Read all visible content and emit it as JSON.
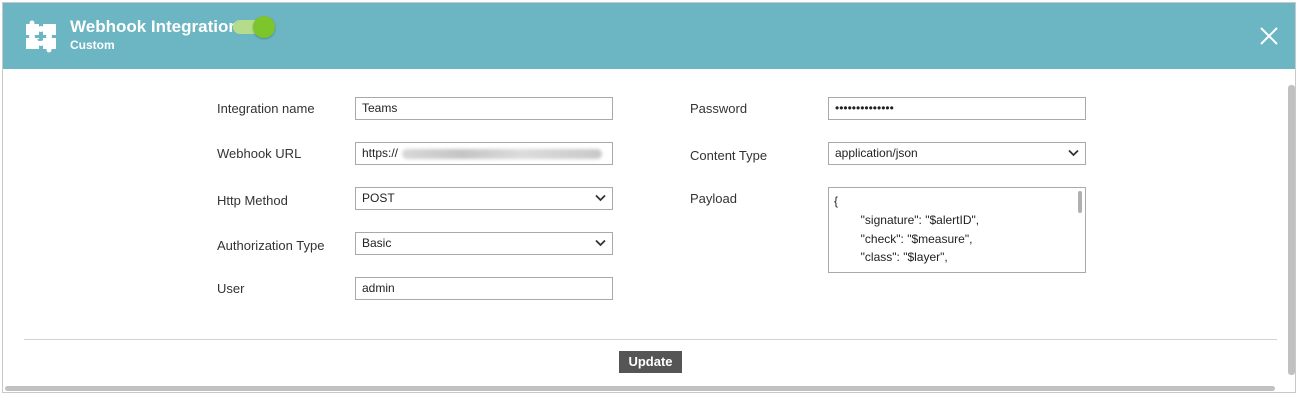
{
  "header": {
    "title": "Webhook Integration",
    "subtitle": "Custom",
    "enabled": true,
    "accent_color": "#6cb5c3",
    "toggle_color": "#7cc52a",
    "logo_icon": "puzzle-icon",
    "close_icon": "close-icon"
  },
  "form": {
    "integration_name": {
      "label": "Integration name",
      "value": "Teams"
    },
    "webhook_url": {
      "label": "Webhook URL",
      "value": "https://"
    },
    "http_method": {
      "label": "Http Method",
      "value": "POST"
    },
    "authorization_type": {
      "label": "Authorization Type",
      "value": "Basic"
    },
    "user": {
      "label": "User",
      "value": "admin"
    },
    "password": {
      "label": "Password",
      "value": "••••••••••••••"
    },
    "content_type": {
      "label": "Content Type",
      "value": "application/json"
    },
    "payload": {
      "label": "Payload",
      "lines": [
        "{",
        "        \"signature\": \"$alertID\",",
        "        \"check\": \"$measure\",",
        "        \"class\": \"$layer\","
      ]
    }
  },
  "footer": {
    "update_label": "Update",
    "button_color": "#555555"
  }
}
